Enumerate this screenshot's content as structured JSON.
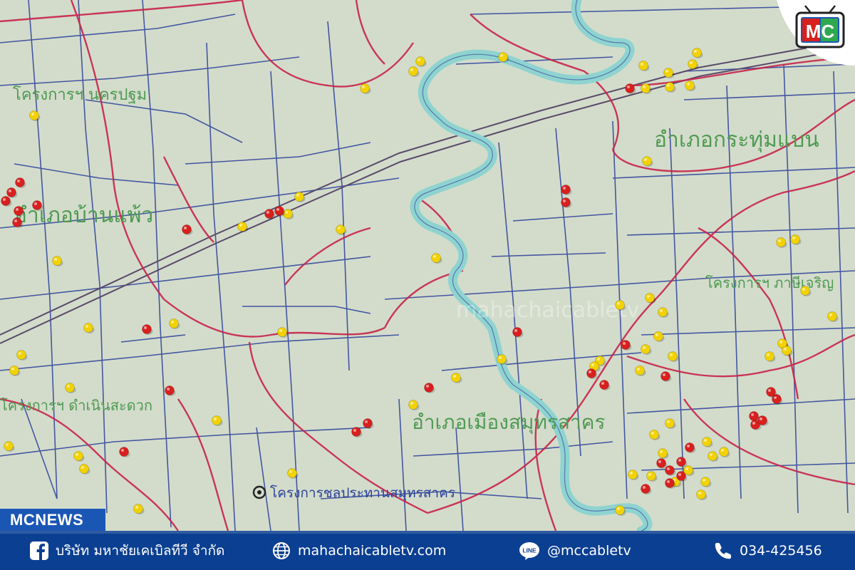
{
  "map": {
    "labels": {
      "nakhon_pathom": "โครงการฯ นครปฐม",
      "ban_phaeo": "อำเภอบ้านแพ้ว",
      "krathum_baen": "อำเภอกระทุ่มแบน",
      "muang": "อำเภอเมืองสมุทรสาคร",
      "damnoen": "โครงการฯ ดำเนินสะดวก",
      "phasi_charoen": "โครงการฯ ภาษีเจริญ",
      "project_sakhon": "โครงการชลประทานสมุทรสาคร"
    },
    "colors": {
      "background": "#d3dccb",
      "canal_blue": "#2a3f9a",
      "boundary_red": "#c8244a",
      "district_green": "#5aa35a",
      "river_fill": "#8fd3d0",
      "pin_yellow": "#f2d200",
      "pin_red": "#d8201e"
    }
  },
  "overlay": {
    "brand_tab": "MCNEWS",
    "logo_text": "MC",
    "watermark": "mahachaicabletv"
  },
  "footer": {
    "company": "บริษัท มหาชัยเคเบิลทีวี จำกัด",
    "website": "mahachaicabletv.com",
    "line_id": "@mccabletv",
    "phone": "034-425456",
    "line_label": "LINE"
  }
}
